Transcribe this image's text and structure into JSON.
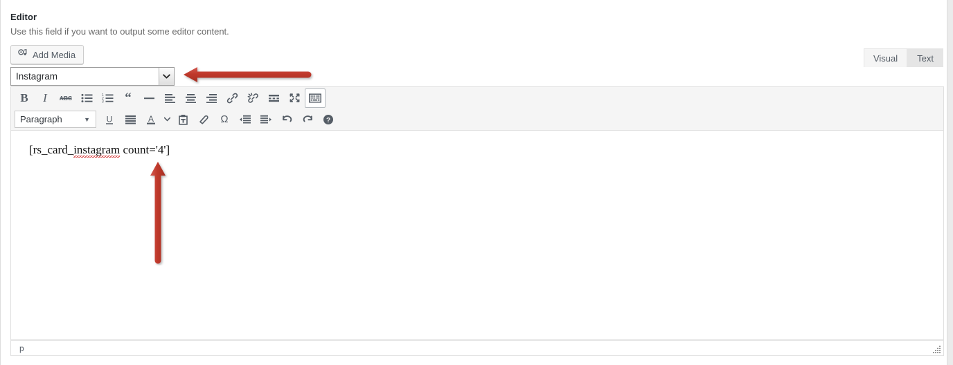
{
  "field": {
    "title": "Editor",
    "description": "Use this field if you want to output some editor content."
  },
  "toolbar_top": {
    "add_media_label": "Add Media",
    "add_media_icon": "media-icon"
  },
  "select": {
    "value": "Instagram",
    "chevron_icon": "chevron-down-icon"
  },
  "tabs": [
    {
      "label": "Visual",
      "active": true
    },
    {
      "label": "Text",
      "active": false
    }
  ],
  "editor_toolbar": {
    "row1": [
      {
        "name": "bold-icon",
        "title": "Bold"
      },
      {
        "name": "italic-icon",
        "title": "Italic"
      },
      {
        "name": "strikethrough-icon",
        "title": "Strikethrough"
      },
      {
        "name": "bullet-list-icon",
        "title": "Bulleted list"
      },
      {
        "name": "numbered-list-icon",
        "title": "Numbered list"
      },
      {
        "name": "blockquote-icon",
        "title": "Blockquote"
      },
      {
        "name": "horizontal-rule-icon",
        "title": "Horizontal line"
      },
      {
        "name": "align-left-icon",
        "title": "Align left"
      },
      {
        "name": "align-center-icon",
        "title": "Align center"
      },
      {
        "name": "align-right-icon",
        "title": "Align right"
      },
      {
        "name": "link-icon",
        "title": "Insert/edit link"
      },
      {
        "name": "unlink-icon",
        "title": "Remove link"
      },
      {
        "name": "read-more-icon",
        "title": "Insert Read More tag"
      },
      {
        "name": "fullscreen-icon",
        "title": "Distraction-free writing mode"
      },
      {
        "name": "toolbar-toggle-icon",
        "title": "Toolbar Toggle",
        "pressed": true
      }
    ],
    "row2": [
      {
        "name": "underline-icon",
        "title": "Underline"
      },
      {
        "name": "align-justify-icon",
        "title": "Justify"
      },
      {
        "name": "text-color-icon",
        "title": "Text color"
      },
      {
        "name": "text-color-chevron-icon",
        "title": "Text color options"
      },
      {
        "name": "paste-as-text-icon",
        "title": "Paste as text"
      },
      {
        "name": "clear-formatting-icon",
        "title": "Clear formatting"
      },
      {
        "name": "special-character-icon",
        "title": "Special character"
      },
      {
        "name": "outdent-icon",
        "title": "Decrease indent"
      },
      {
        "name": "indent-icon",
        "title": "Increase indent"
      },
      {
        "name": "undo-icon",
        "title": "Undo"
      },
      {
        "name": "redo-icon",
        "title": "Redo"
      },
      {
        "name": "help-icon",
        "title": "Keyboard Shortcuts"
      }
    ],
    "format_select": {
      "value": "Paragraph",
      "chevron_icon": "chevron-down-icon"
    }
  },
  "content": {
    "shortcode_prefix": "[rs_card_",
    "shortcode_misspelled": "instagram",
    "shortcode_suffix": " count='4']",
    "full_text": "[rs_card_instagram count='4']"
  },
  "statusbar": {
    "path": "p",
    "resize_icon": "resize-grip-icon"
  },
  "annotations": [
    {
      "name": "arrow-pointing-to-select",
      "direction": "left",
      "color": "#c0392b"
    },
    {
      "name": "arrow-pointing-to-shortcode",
      "direction": "up",
      "color": "#c0392b"
    }
  ],
  "colors": {
    "annotation_red": "#c0392b",
    "toolbar_bg": "#f5f5f5",
    "icon": "#555d66",
    "text": "#23282d"
  }
}
